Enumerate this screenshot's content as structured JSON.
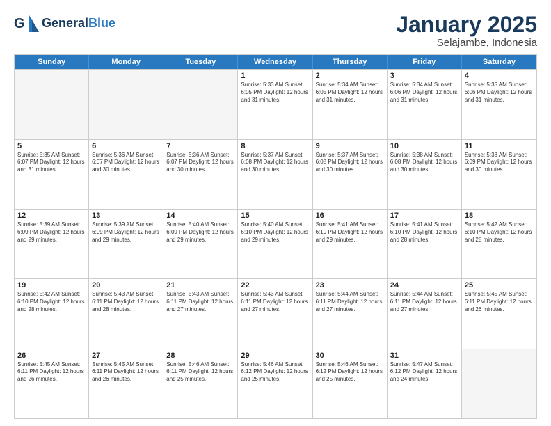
{
  "header": {
    "logo_general": "General",
    "logo_blue": "Blue",
    "title": "January 2025",
    "subtitle": "Selajambe, Indonesia"
  },
  "weekdays": [
    "Sunday",
    "Monday",
    "Tuesday",
    "Wednesday",
    "Thursday",
    "Friday",
    "Saturday"
  ],
  "weeks": [
    [
      {
        "day": "",
        "info": ""
      },
      {
        "day": "",
        "info": ""
      },
      {
        "day": "",
        "info": ""
      },
      {
        "day": "1",
        "info": "Sunrise: 5:33 AM\nSunset: 6:05 PM\nDaylight: 12 hours\nand 31 minutes."
      },
      {
        "day": "2",
        "info": "Sunrise: 5:34 AM\nSunset: 6:05 PM\nDaylight: 12 hours\nand 31 minutes."
      },
      {
        "day": "3",
        "info": "Sunrise: 5:34 AM\nSunset: 6:06 PM\nDaylight: 12 hours\nand 31 minutes."
      },
      {
        "day": "4",
        "info": "Sunrise: 5:35 AM\nSunset: 6:06 PM\nDaylight: 12 hours\nand 31 minutes."
      }
    ],
    [
      {
        "day": "5",
        "info": "Sunrise: 5:35 AM\nSunset: 6:07 PM\nDaylight: 12 hours\nand 31 minutes."
      },
      {
        "day": "6",
        "info": "Sunrise: 5:36 AM\nSunset: 6:07 PM\nDaylight: 12 hours\nand 30 minutes."
      },
      {
        "day": "7",
        "info": "Sunrise: 5:36 AM\nSunset: 6:07 PM\nDaylight: 12 hours\nand 30 minutes."
      },
      {
        "day": "8",
        "info": "Sunrise: 5:37 AM\nSunset: 6:08 PM\nDaylight: 12 hours\nand 30 minutes."
      },
      {
        "day": "9",
        "info": "Sunrise: 5:37 AM\nSunset: 6:08 PM\nDaylight: 12 hours\nand 30 minutes."
      },
      {
        "day": "10",
        "info": "Sunrise: 5:38 AM\nSunset: 6:08 PM\nDaylight: 12 hours\nand 30 minutes."
      },
      {
        "day": "11",
        "info": "Sunrise: 5:38 AM\nSunset: 6:09 PM\nDaylight: 12 hours\nand 30 minutes."
      }
    ],
    [
      {
        "day": "12",
        "info": "Sunrise: 5:39 AM\nSunset: 6:09 PM\nDaylight: 12 hours\nand 29 minutes."
      },
      {
        "day": "13",
        "info": "Sunrise: 5:39 AM\nSunset: 6:09 PM\nDaylight: 12 hours\nand 29 minutes."
      },
      {
        "day": "14",
        "info": "Sunrise: 5:40 AM\nSunset: 6:09 PM\nDaylight: 12 hours\nand 29 minutes."
      },
      {
        "day": "15",
        "info": "Sunrise: 5:40 AM\nSunset: 6:10 PM\nDaylight: 12 hours\nand 29 minutes."
      },
      {
        "day": "16",
        "info": "Sunrise: 5:41 AM\nSunset: 6:10 PM\nDaylight: 12 hours\nand 29 minutes."
      },
      {
        "day": "17",
        "info": "Sunrise: 5:41 AM\nSunset: 6:10 PM\nDaylight: 12 hours\nand 28 minutes."
      },
      {
        "day": "18",
        "info": "Sunrise: 5:42 AM\nSunset: 6:10 PM\nDaylight: 12 hours\nand 28 minutes."
      }
    ],
    [
      {
        "day": "19",
        "info": "Sunrise: 5:42 AM\nSunset: 6:10 PM\nDaylight: 12 hours\nand 28 minutes."
      },
      {
        "day": "20",
        "info": "Sunrise: 5:43 AM\nSunset: 6:11 PM\nDaylight: 12 hours\nand 28 minutes."
      },
      {
        "day": "21",
        "info": "Sunrise: 5:43 AM\nSunset: 6:11 PM\nDaylight: 12 hours\nand 27 minutes."
      },
      {
        "day": "22",
        "info": "Sunrise: 5:43 AM\nSunset: 6:11 PM\nDaylight: 12 hours\nand 27 minutes."
      },
      {
        "day": "23",
        "info": "Sunrise: 5:44 AM\nSunset: 6:11 PM\nDaylight: 12 hours\nand 27 minutes."
      },
      {
        "day": "24",
        "info": "Sunrise: 5:44 AM\nSunset: 6:11 PM\nDaylight: 12 hours\nand 27 minutes."
      },
      {
        "day": "25",
        "info": "Sunrise: 5:45 AM\nSunset: 6:11 PM\nDaylight: 12 hours\nand 26 minutes."
      }
    ],
    [
      {
        "day": "26",
        "info": "Sunrise: 5:45 AM\nSunset: 6:11 PM\nDaylight: 12 hours\nand 26 minutes."
      },
      {
        "day": "27",
        "info": "Sunrise: 5:45 AM\nSunset: 6:11 PM\nDaylight: 12 hours\nand 26 minutes."
      },
      {
        "day": "28",
        "info": "Sunrise: 5:46 AM\nSunset: 6:11 PM\nDaylight: 12 hours\nand 25 minutes."
      },
      {
        "day": "29",
        "info": "Sunrise: 5:46 AM\nSunset: 6:12 PM\nDaylight: 12 hours\nand 25 minutes."
      },
      {
        "day": "30",
        "info": "Sunrise: 5:46 AM\nSunset: 6:12 PM\nDaylight: 12 hours\nand 25 minutes."
      },
      {
        "day": "31",
        "info": "Sunrise: 5:47 AM\nSunset: 6:12 PM\nDaylight: 12 hours\nand 24 minutes."
      },
      {
        "day": "",
        "info": ""
      }
    ]
  ]
}
